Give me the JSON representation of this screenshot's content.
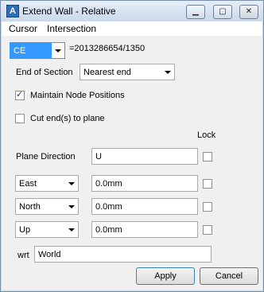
{
  "window": {
    "title": "Extend Wall - Relative",
    "icon": "app-icon",
    "controls": [
      "minimize",
      "maximize",
      "close"
    ]
  },
  "menu": {
    "items": [
      {
        "label": "Cursor"
      },
      {
        "label": "Intersection"
      }
    ]
  },
  "element": {
    "type_select": "CE",
    "reference": "=2013286654/1350"
  },
  "end_of_section": {
    "label": "End of Section",
    "value": "Nearest end"
  },
  "options": {
    "maintain_node_positions": {
      "label": "Maintain Node Positions",
      "checked": true
    },
    "cut_ends_to_plane": {
      "label": "Cut end(s) to plane",
      "checked": false
    }
  },
  "lock_header": "Lock",
  "plane_direction": {
    "label": "Plane Direction",
    "value": "U",
    "locked": false
  },
  "rows": [
    {
      "direction": "East",
      "value": "0.0mm",
      "locked": false
    },
    {
      "direction": "North",
      "value": "0.0mm",
      "locked": false
    },
    {
      "direction": "Up",
      "value": "0.0mm",
      "locked": false
    }
  ],
  "wrt": {
    "label": "wrt",
    "value": "World"
  },
  "buttons": {
    "apply": "Apply",
    "cancel": "Cancel"
  },
  "colors": {
    "selection_blue": "#3399ff",
    "dialog_bg": "#f0f0f0",
    "titlebar": "#c9d8ea"
  }
}
